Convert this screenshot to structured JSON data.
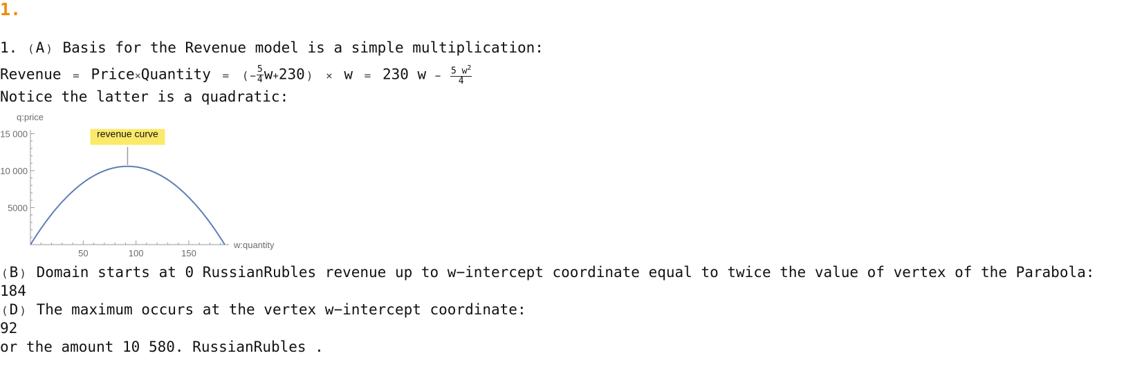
{
  "section": {
    "number": "1."
  },
  "partA": {
    "lead": "1. ",
    "paren_open": "(",
    "letter": "A",
    "paren_close": ")",
    "text": " Basis for the Revenue model is a simple multiplication:"
  },
  "formula": {
    "lhs": "Revenue",
    "eq1": "=",
    "product_left": "Price",
    "times1": "×",
    "product_right": "Quantity",
    "eq2": "=",
    "paren_open": "(",
    "minus": "−",
    "frac1_num": "5",
    "frac1_den": "4",
    "term1_var": "w",
    "plus": "+",
    "const": "230",
    "paren_close": ")",
    "times2": "×",
    "w": "w",
    "eq3": "=",
    "result_term1": "230 w",
    "minus2": "−",
    "frac2_num_base": "5 w",
    "frac2_num_exp": "2",
    "frac2_den": "4"
  },
  "notice": {
    "text": "Notice the latter is a quadratic:"
  },
  "chart_data": {
    "type": "line",
    "xlabel": "w:quantity",
    "ylabel": "q:price",
    "xlim": [
      0,
      188
    ],
    "ylim": [
      0,
      15500
    ],
    "xticks": [
      50,
      100,
      150
    ],
    "yticks": [
      5000,
      10000,
      15000
    ],
    "xtick_labels": [
      "50",
      "100",
      "150"
    ],
    "ytick_labels": [
      "5000",
      "10 000",
      "15 000"
    ],
    "grid": false,
    "series": [
      {
        "color": "#5b7fb5",
        "function": "230w - 5w^2/4",
        "x_range": [
          0,
          184
        ],
        "points": [
          [
            0,
            0
          ],
          [
            20,
            4100
          ],
          [
            40,
            7200
          ],
          [
            60,
            9300
          ],
          [
            80,
            10400
          ],
          [
            92,
            10580
          ],
          [
            100,
            10500
          ],
          [
            120,
            9600
          ],
          [
            140,
            7700
          ],
          [
            160,
            4800
          ],
          [
            184,
            0
          ]
        ]
      }
    ],
    "annotation": {
      "text": "revenue curve",
      "x": 92,
      "y": 10580,
      "background": "#fbe96a"
    }
  },
  "partB": {
    "paren_open": "(",
    "letter": "B",
    "paren_close": ")",
    "text": " Domain starts at 0 RussianRubles revenue up to w−intercept coordinate equal to twice the value of vertex of the Parabola:",
    "value": "184"
  },
  "partD": {
    "paren_open": "(",
    "letter": "D",
    "paren_close": ")",
    "text": " The maximum occurs at the vertex w−intercept coordinate:",
    "value": "92",
    "amount_prefix": "or the amount ",
    "amount": "10 580.",
    "amount_suffix": " RussianRubles ."
  }
}
